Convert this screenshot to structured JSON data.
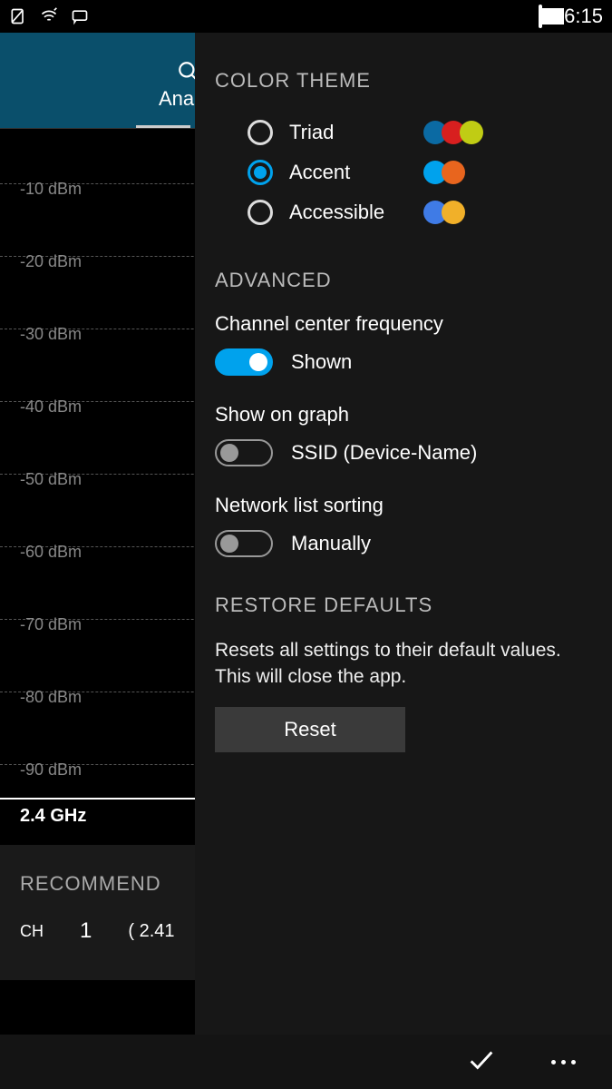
{
  "status": {
    "time": "06:15"
  },
  "header": {
    "tab": "Ana"
  },
  "graph": {
    "levels": [
      "-10 dBm",
      "-20 dBm",
      "-30 dBm",
      "-40 dBm",
      "-50 dBm",
      "-60 dBm",
      "-70 dBm",
      "-80 dBm",
      "-90 dBm"
    ],
    "band": "2.4 GHz"
  },
  "recommend": {
    "title": "RECOMMEND",
    "ch_label": "CH",
    "ch_value": "1",
    "freq": "( 2.41"
  },
  "panel": {
    "color_theme": {
      "title": "COLOR THEME",
      "options": [
        {
          "label": "Triad",
          "selected": false,
          "colors": [
            "#0b6aa3",
            "#d81f1f",
            "#c0cc14"
          ]
        },
        {
          "label": "Accent",
          "selected": true,
          "colors": [
            "#00a2ed",
            "#e8651e"
          ]
        },
        {
          "label": "Accessible",
          "selected": false,
          "colors": [
            "#3f7be6",
            "#f1b029"
          ]
        }
      ]
    },
    "advanced": {
      "title": "ADVANCED",
      "freq": {
        "label": "Channel center frequency",
        "value": "Shown",
        "on": true
      },
      "show_graph": {
        "label": "Show on graph",
        "value": "SSID (Device-Name)",
        "on": false
      },
      "sort": {
        "label": "Network list sorting",
        "value": "Manually",
        "on": false
      }
    },
    "restore": {
      "title": "RESTORE DEFAULTS",
      "desc": "Resets all settings to their default values. This will close the app.",
      "button": "Reset"
    }
  }
}
